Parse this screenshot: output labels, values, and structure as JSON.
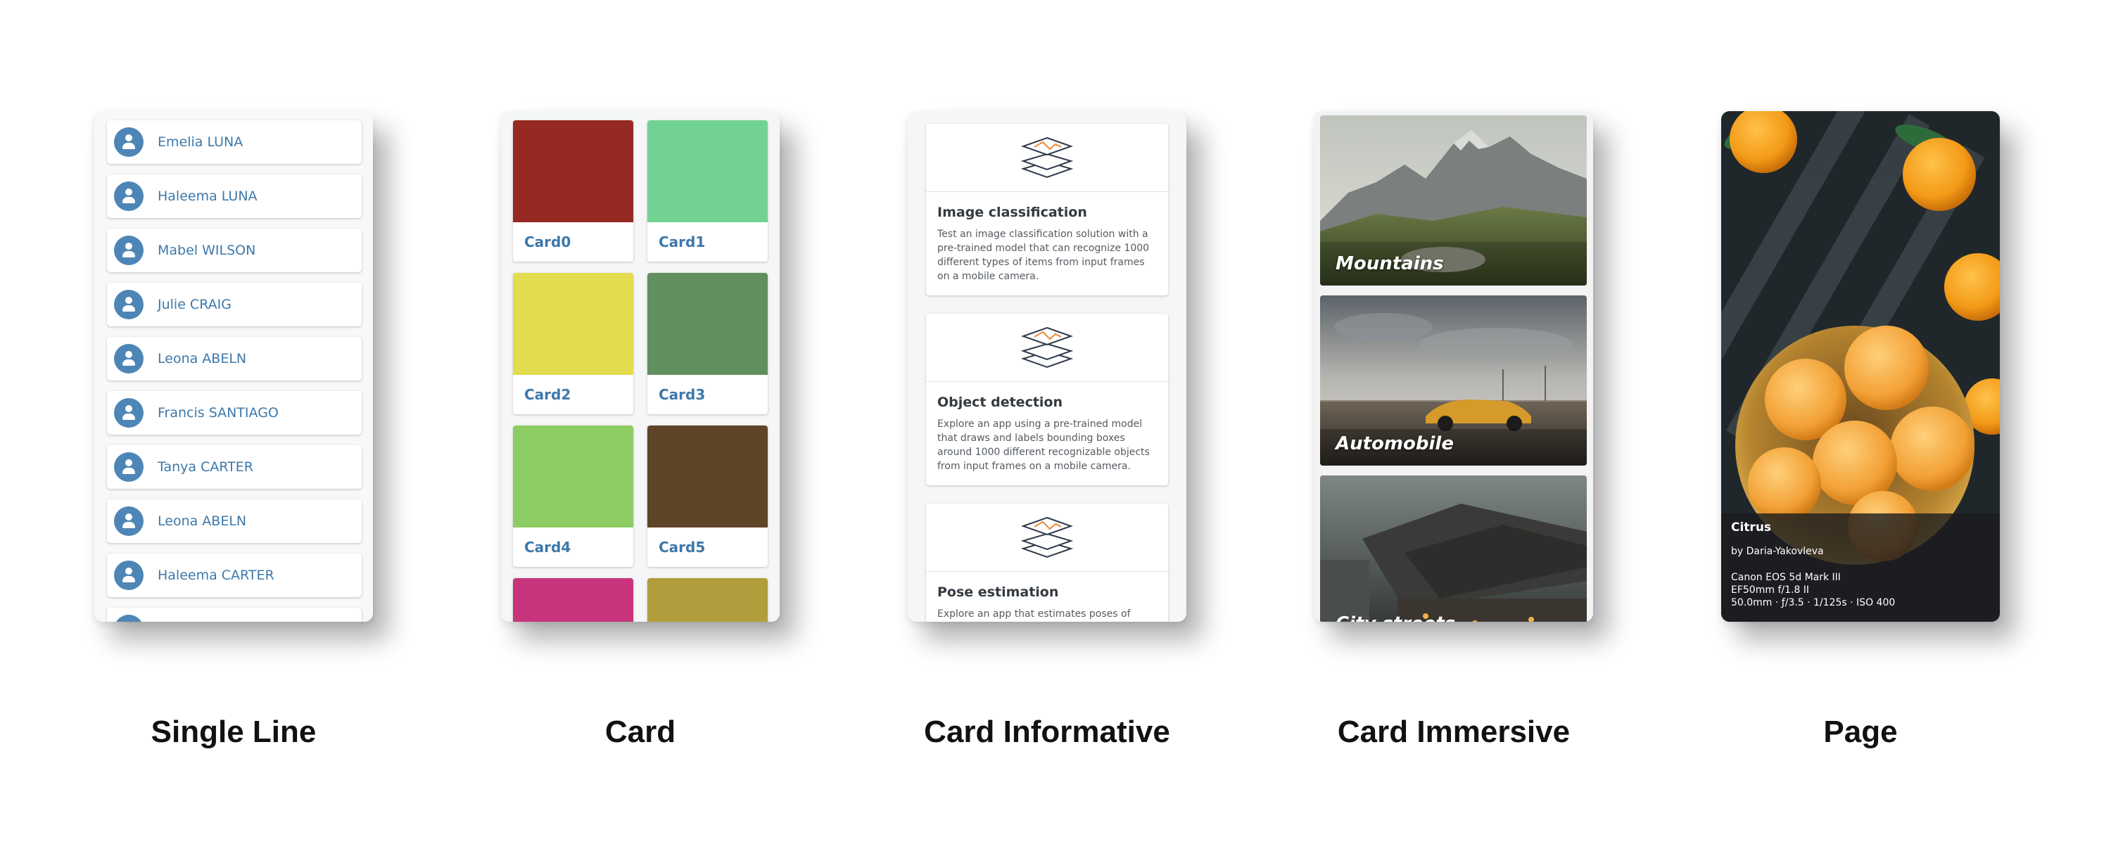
{
  "single_line": {
    "caption": "Single Line",
    "items": [
      {
        "name": "Emelia LUNA"
      },
      {
        "name": "Haleema LUNA"
      },
      {
        "name": "Mabel WILSON"
      },
      {
        "name": "Julie CRAIG"
      },
      {
        "name": "Leona ABELN"
      },
      {
        "name": "Francis SANTIAGO"
      },
      {
        "name": "Tanya CARTER"
      },
      {
        "name": "Leona ABELN"
      },
      {
        "name": "Haleema CARTER"
      },
      {
        "name": ""
      }
    ]
  },
  "card": {
    "caption": "Card",
    "items": [
      {
        "label": "Card0",
        "color": "#962a22"
      },
      {
        "label": "Card1",
        "color": "#72d293"
      },
      {
        "label": "Card2",
        "color": "#e2dc4e"
      },
      {
        "label": "Card3",
        "color": "#628f5f"
      },
      {
        "label": "Card4",
        "color": "#8ccc62"
      },
      {
        "label": "Card5",
        "color": "#5f4527"
      },
      {
        "label": "",
        "color": "#c8347c"
      },
      {
        "label": "",
        "color": "#b09e3c"
      }
    ]
  },
  "card_informative": {
    "caption": "Card Informative",
    "items": [
      {
        "title": "Image classification",
        "icon": "layers-classification-icon",
        "description": "Test an image classification solution with a pre-trained model that can recognize 1000 different types of items from input frames on a mobile camera."
      },
      {
        "title": "Object detection",
        "icon": "layers-detection-icon",
        "description": "Explore an app using a pre-trained model that draws and labels bounding boxes around 1000 different recognizable objects from input frames on a mobile camera."
      },
      {
        "title": "Pose estimation",
        "icon": "layers-pose-icon",
        "description": "Explore an app that estimates poses of"
      }
    ]
  },
  "card_immersive": {
    "caption": "Card Immersive",
    "items": [
      {
        "label": "Mountains",
        "image": "mountains-photo"
      },
      {
        "label": "Automobile",
        "image": "automobile-photo"
      },
      {
        "label": "City streets",
        "image": "city-streets-photo"
      }
    ]
  },
  "page": {
    "caption": "Page",
    "image": "citrus-photo",
    "title": "Citrus",
    "author": "by Daria-Yakovleva",
    "camera": "Canon EOS 5d Mark III",
    "lens": "EF50mm f/1.8 II",
    "settings": "50.0mm · ƒ/3.5 · 1/125s · ISO 400"
  }
}
